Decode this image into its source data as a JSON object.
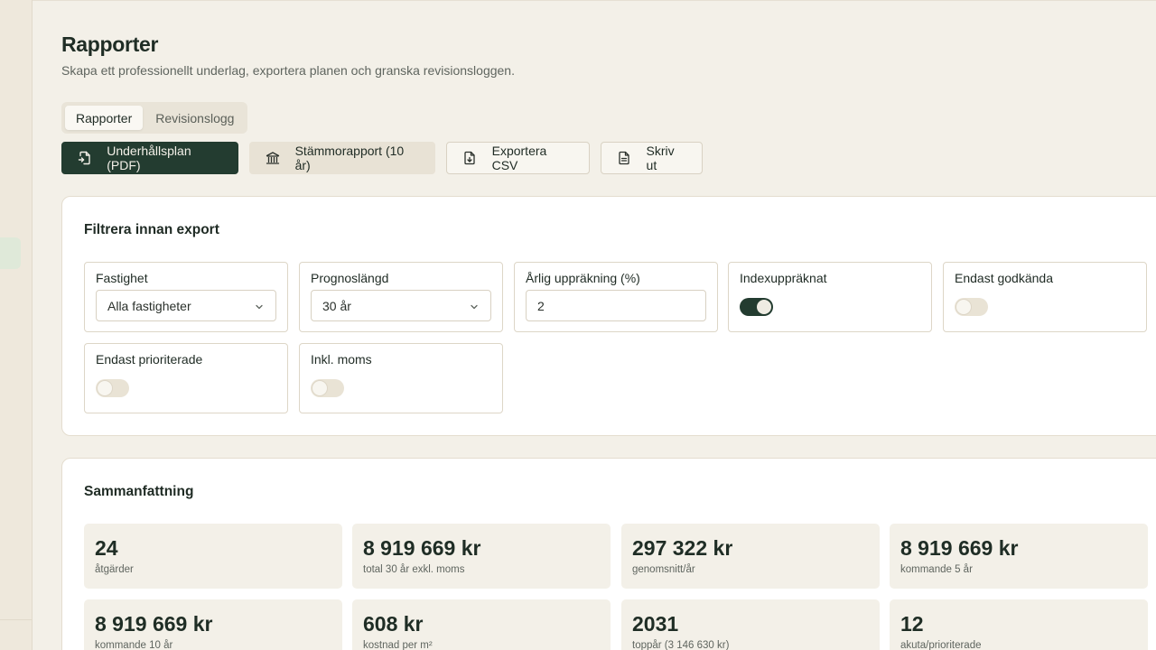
{
  "page": {
    "title": "Rapporter",
    "subtitle": "Skapa ett professionellt underlag, exportera planen och granska revisionsloggen."
  },
  "tabs": [
    {
      "label": "Rapporter",
      "active": true
    },
    {
      "label": "Revisionslogg",
      "active": false
    }
  ],
  "actions": {
    "pdf": {
      "label": "Underhållsplan (PDF)",
      "icon": "file-export-icon"
    },
    "meeting": {
      "label": "Stämmorapport (10 år)",
      "icon": "bank-icon"
    },
    "csv": {
      "label": "Exportera CSV",
      "icon": "file-download-icon"
    },
    "print": {
      "label": "Skriv ut",
      "icon": "document-icon"
    }
  },
  "filters": {
    "title": "Filtrera innan export",
    "property": {
      "label": "Fastighet",
      "value": "Alla fastigheter"
    },
    "forecast": {
      "label": "Prognoslängd",
      "value": "30 år"
    },
    "inflation": {
      "label": "Årlig uppräkning (%)",
      "value": "2"
    },
    "indexed": {
      "label": "Indexuppräknat",
      "on": true
    },
    "approved_only": {
      "label": "Endast godkända",
      "on": false
    },
    "prioritized_only": {
      "label": "Endast prioriterade",
      "on": false
    },
    "incl_vat": {
      "label": "Inkl. moms",
      "on": false
    }
  },
  "summary": {
    "title": "Sammanfattning",
    "stats": [
      {
        "value": "24",
        "label": "åtgärder"
      },
      {
        "value": "8 919 669 kr",
        "label": "total 30 år exkl. moms"
      },
      {
        "value": "297 322 kr",
        "label": "genomsnitt/år"
      },
      {
        "value": "8 919 669 kr",
        "label": "kommande 5 år"
      },
      {
        "value": "8 919 669 kr",
        "label": "kommande 10 år"
      },
      {
        "value": "608 kr",
        "label": "kostnad per m²"
      },
      {
        "value": "2031",
        "label": "toppår (3 146 630 kr)"
      },
      {
        "value": "12",
        "label": "akuta/prioriterade"
      }
    ]
  },
  "colors": {
    "background": "#f3f0e8",
    "primary": "#233c30",
    "card": "#ffffff",
    "stat_bg": "#f3f0e8"
  }
}
